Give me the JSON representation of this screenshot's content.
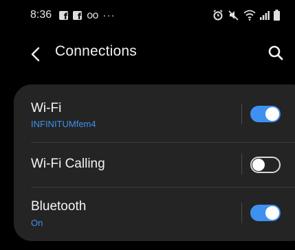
{
  "status_bar": {
    "time": "8:36",
    "icons": [
      "facebook-icon",
      "facebook-icon",
      "voicemail-icon",
      "more-icon",
      "alarm-icon",
      "mute-icon",
      "wifi-icon",
      "signal-icon",
      "battery-icon"
    ]
  },
  "header": {
    "title": "Connections",
    "back_icon": "back-arrow-icon",
    "search_icon": "search-icon"
  },
  "settings": {
    "items": [
      {
        "label": "Wi-Fi",
        "sublabel": "INFINITUMfem4",
        "enabled": true
      },
      {
        "label": "Wi-Fi Calling",
        "sublabel": "",
        "enabled": false
      },
      {
        "label": "Bluetooth",
        "sublabel": "On",
        "enabled": true
      }
    ]
  },
  "colors": {
    "accent": "#3e91f0",
    "background": "#000000",
    "card": "#242424"
  }
}
